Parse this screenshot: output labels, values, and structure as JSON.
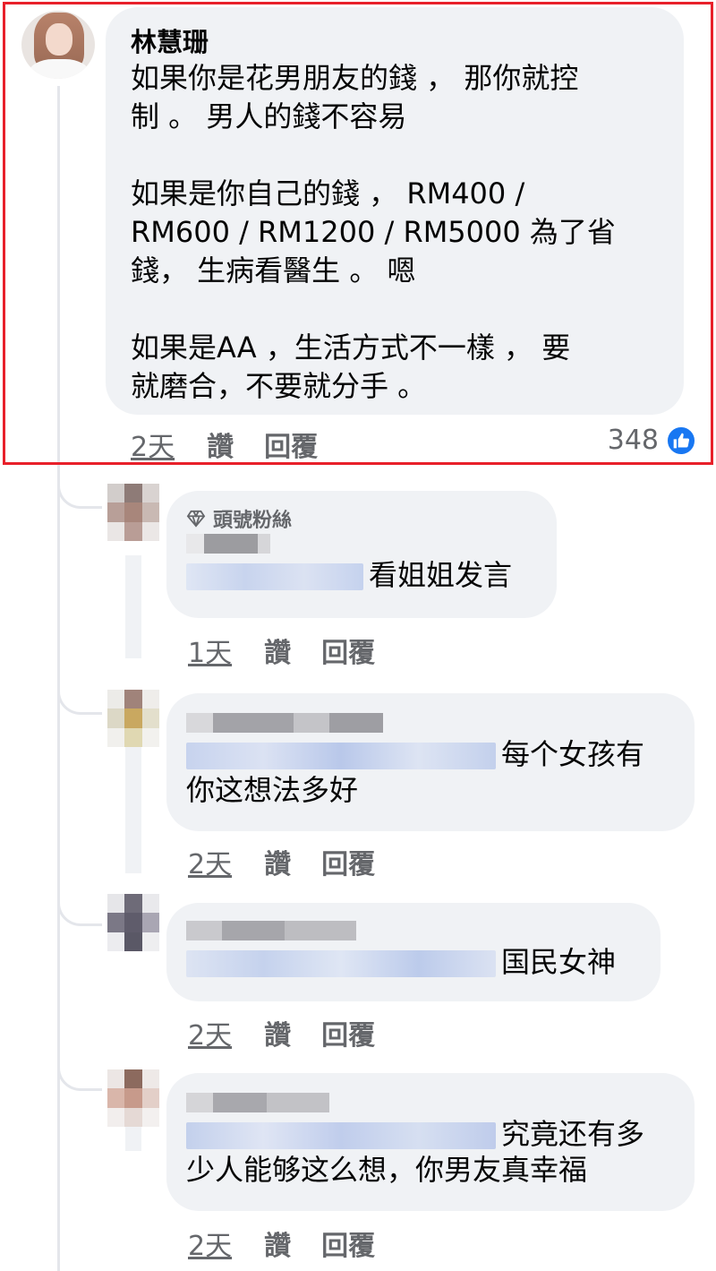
{
  "main_comment": {
    "author": "林慧珊",
    "lines": [
      "如果你是花男朋友的錢 ， 那你就控",
      "制 。 男人的錢不容易",
      "",
      "如果是你自己的錢 ， RM400 /",
      "RM600 / RM1200 / RM5000  為了省",
      "錢， 生病看醫生 。 嗯",
      "",
      "如果是AA ，生活方式不一樣 ， 要",
      "就磨合，不要就分手 。"
    ],
    "time": "2天",
    "like_label": "讚",
    "reply_label": "回覆",
    "reaction_count": "348",
    "reaction_icon": "thumbs-up-icon"
  },
  "replies": [
    {
      "badge": "頭號粉絲",
      "text_line1": "看姐姐发言",
      "text_line2": "",
      "time": "1天",
      "like_label": "讚",
      "reply_label": "回覆"
    },
    {
      "badge": "",
      "text_line1": "每个女孩有",
      "text_line2": "你这想法多好",
      "time": "2天",
      "like_label": "讚",
      "reply_label": "回覆"
    },
    {
      "badge": "",
      "text_line1": "国民女神",
      "text_line2": "",
      "time": "2天",
      "like_label": "讚",
      "reply_label": "回覆"
    },
    {
      "badge": "",
      "text_line1": "究竟还有多",
      "text_line2": "少人能够这么想，你男友真幸福",
      "time": "2天",
      "like_label": "讚",
      "reply_label": "回覆"
    }
  ],
  "colors": {
    "highlight": "#e8202a",
    "bubble": "#f0f2f5",
    "meta_text": "#65676b",
    "like_blue": "#1877f2"
  }
}
